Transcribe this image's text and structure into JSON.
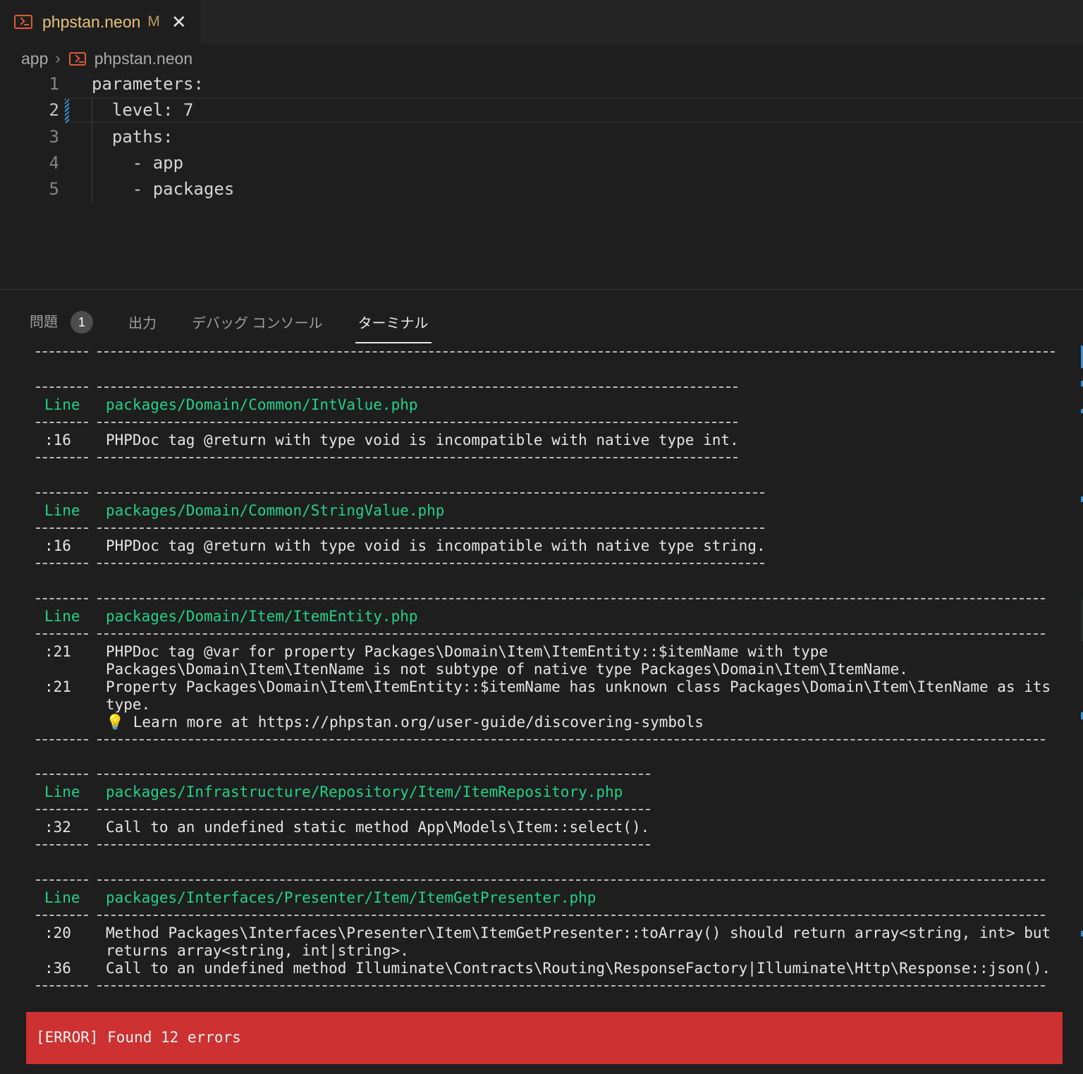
{
  "tab": {
    "filename": "phpstan.neon",
    "modified": "M",
    "close": "✕"
  },
  "breadcrumb": {
    "folder": "app",
    "separator": "›",
    "file": "phpstan.neon"
  },
  "editor": {
    "lines": [
      {
        "num": "1",
        "code": "parameters:"
      },
      {
        "num": "2",
        "code": "  level: 7"
      },
      {
        "num": "3",
        "code": "  paths:"
      },
      {
        "num": "4",
        "code": "    - app"
      },
      {
        "num": "5",
        "code": "    - packages"
      }
    ]
  },
  "panel": {
    "tabs": [
      "問題",
      "出力",
      "デバッグ コンソール",
      "ターミナル"
    ],
    "problems_count": "1"
  },
  "terminal": {
    "blocks": [
      {
        "line_label": "Line",
        "file": "packages/Domain/Common/IntValue.php",
        "rows": [
          {
            "no": ":16",
            "msg": "PHPDoc tag @return with type void is incompatible with native type int."
          }
        ]
      },
      {
        "line_label": "Line",
        "file": "packages/Domain/Common/StringValue.php",
        "rows": [
          {
            "no": ":16",
            "msg": "PHPDoc tag @return with type void is incompatible with native type string."
          }
        ]
      },
      {
        "line_label": "Line",
        "file": "packages/Domain/Item/ItemEntity.php",
        "rows": [
          {
            "no": ":21",
            "msg": "PHPDoc tag @var for property Packages\\Domain\\Item\\ItemEntity::$itemName with type"
          },
          {
            "no": "",
            "msg": "Packages\\Domain\\Item\\ItenName is not subtype of native type Packages\\Domain\\Item\\ItemName."
          },
          {
            "no": ":21",
            "msg": "Property Packages\\Domain\\Item\\ItemEntity::$itemName has unknown class Packages\\Domain\\Item\\ItenName as its"
          },
          {
            "no": "",
            "msg": "type."
          },
          {
            "no": "",
            "msg": "💡 Learn more at https://phpstan.org/user-guide/discovering-symbols"
          }
        ]
      },
      {
        "line_label": "Line",
        "file": "packages/Infrastructure/Repository/Item/ItemRepository.php",
        "rows": [
          {
            "no": ":32",
            "msg": "Call to an undefined static method App\\Models\\Item::select()."
          }
        ]
      },
      {
        "line_label": "Line",
        "file": "packages/Interfaces/Presenter/Item/ItemGetPresenter.php",
        "rows": [
          {
            "no": ":20",
            "msg": "Method Packages\\Interfaces\\Presenter\\Item\\ItemGetPresenter::toArray() should return array<string, int> but"
          },
          {
            "no": "",
            "msg": "returns array<string, int|string>."
          },
          {
            "no": ":36",
            "msg": "Call to an undefined method Illuminate\\Contracts\\Routing\\ResponseFactory|Illuminate\\Http\\Response::json()."
          }
        ]
      }
    ],
    "error_summary": "[ERROR] Found 12 errors"
  },
  "colors": {
    "header_green": "#23d18b",
    "error_red": "#cd3131",
    "tab_name": "#e8c07a",
    "file_icon": "#e0583a"
  }
}
